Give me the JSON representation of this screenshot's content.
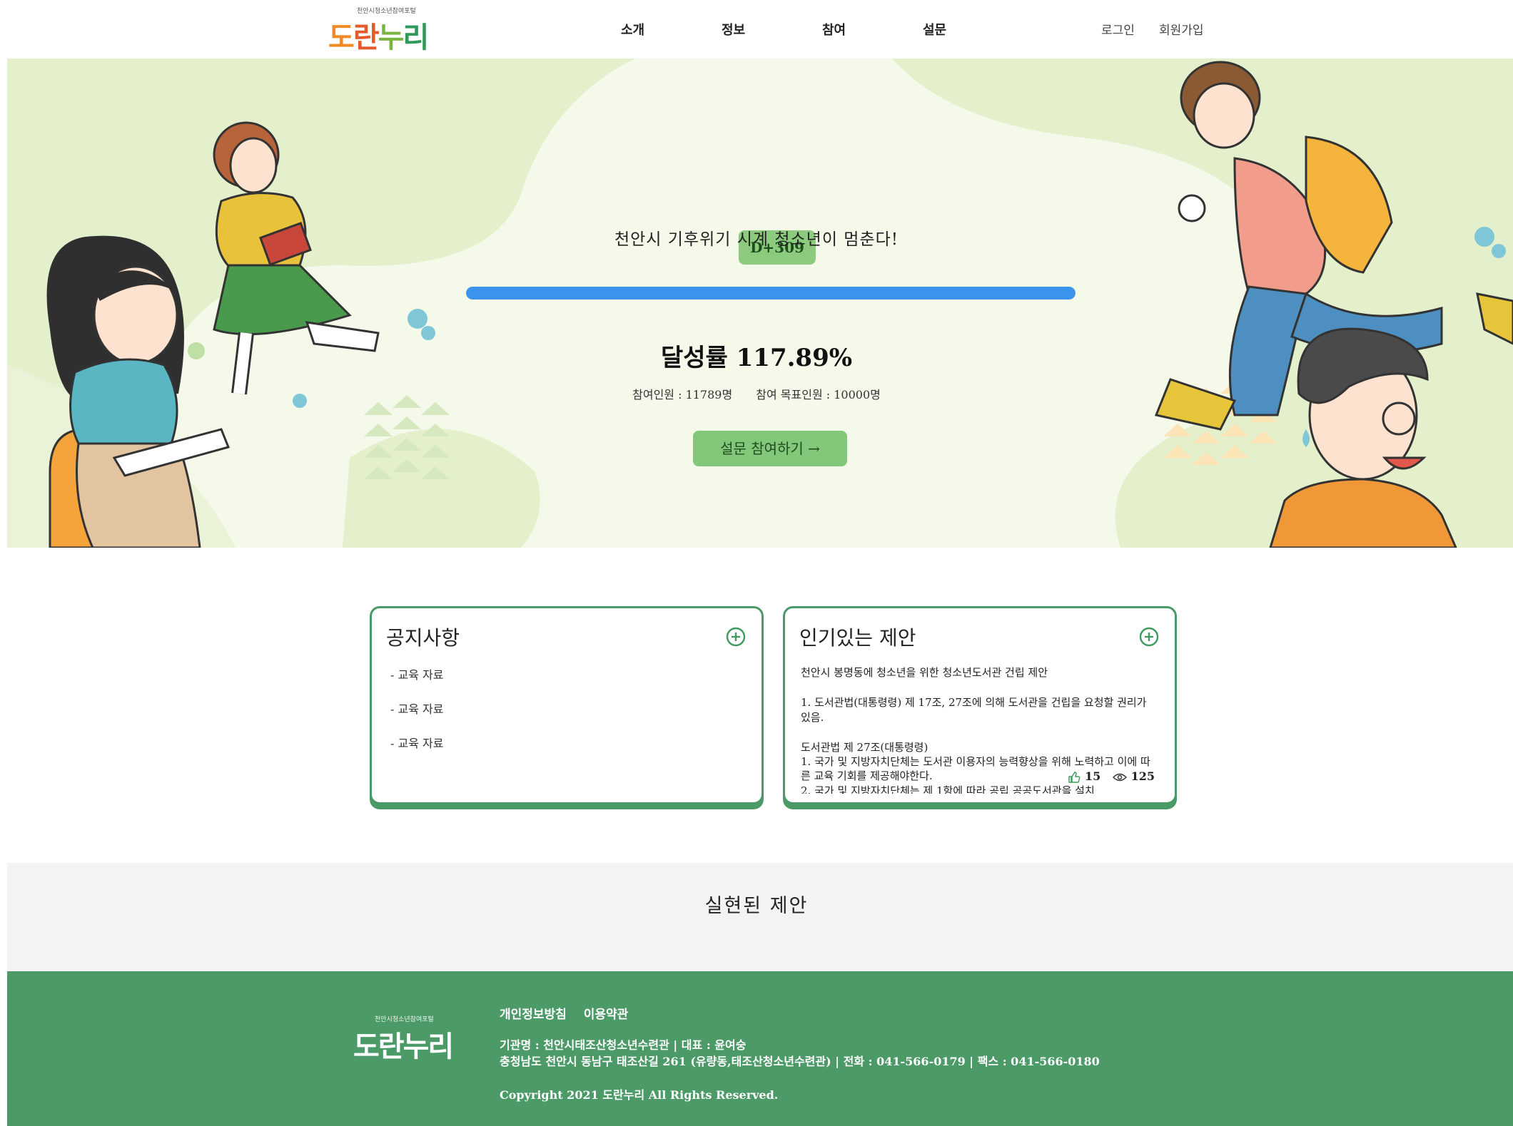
{
  "header": {
    "logo_small": "천안시청소년참여포털",
    "logo_parts": [
      "도",
      "란",
      "누",
      "리"
    ],
    "nav": [
      "소개",
      "정보",
      "참여",
      "설문"
    ],
    "login": "로그인",
    "signup": "회원가입"
  },
  "hero": {
    "dday": "D+309",
    "title": "천안시 기후위기 시계 청소년이 멈춘다!",
    "progress": 1.0,
    "rate_label": "달성률",
    "rate_value": "117.89%",
    "participants": "참여인원 : 11789명",
    "target": "참여 목표인원 : 10000명",
    "cta": "설문 참여하기 →"
  },
  "notice": {
    "title": "공지사항",
    "items": [
      "- 교육 자료",
      "- 교육 자료",
      "- 교육 자료"
    ]
  },
  "popular": {
    "title": "인기있는 제안",
    "subject": "천안시 봉명동에 청소년을 위한 청소년도서관 건립 제안",
    "para1": "1. 도서관법(대통령령) 제 17조, 27조에 의해 도서관을 건립을 요청할 권리가 있음.",
    "para2_title": "도서관법 제 27조(대통령령)",
    "para2_line1": "1. 국가 및 지방자치단체는 도서관 이용자의 능력향상을 위해 노력하고 이에 따른 교육 기회를 제공해야한다.",
    "para2_line2": "2. 국가 및 지방자치단체는 제 1항에 따라 공립 공공도서관을 설치",
    "likes": "15",
    "views": "125"
  },
  "realized": {
    "title": "실현된 제안"
  },
  "footer": {
    "logo_small": "천안시청소년참여포털",
    "logo_main": "도란누리",
    "links": [
      "개인정보방침",
      "이용약관"
    ],
    "info_line1": "기관명 : 천안시태조산청소년수련관 | 대표 : 윤여숭",
    "info_line2": "충청남도 천안시 동남구 태조산길 261 (유량동,태조산청소년수련관) | 전화 : 041-566-0179 | 팩스 : 041-566-0180",
    "copyright": "Copyright 2021 도란누리 All Rights Reserved."
  },
  "colors": {
    "green": "#4b9a67",
    "badge_green": "#8ccb7e",
    "progress_blue": "#3a94ee",
    "hero_bg": "#f5f9ea"
  }
}
